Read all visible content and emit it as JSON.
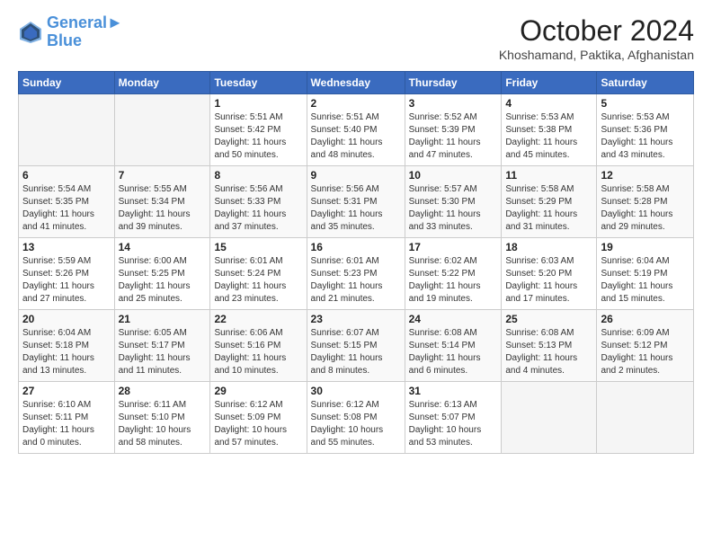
{
  "header": {
    "logo_line1": "General",
    "logo_line2": "Blue",
    "month": "October 2024",
    "location": "Khoshamand, Paktika, Afghanistan"
  },
  "days_of_week": [
    "Sunday",
    "Monday",
    "Tuesday",
    "Wednesday",
    "Thursday",
    "Friday",
    "Saturday"
  ],
  "weeks": [
    [
      {
        "day": "",
        "detail": ""
      },
      {
        "day": "",
        "detail": ""
      },
      {
        "day": "1",
        "detail": "Sunrise: 5:51 AM\nSunset: 5:42 PM\nDaylight: 11 hours\nand 50 minutes."
      },
      {
        "day": "2",
        "detail": "Sunrise: 5:51 AM\nSunset: 5:40 PM\nDaylight: 11 hours\nand 48 minutes."
      },
      {
        "day": "3",
        "detail": "Sunrise: 5:52 AM\nSunset: 5:39 PM\nDaylight: 11 hours\nand 47 minutes."
      },
      {
        "day": "4",
        "detail": "Sunrise: 5:53 AM\nSunset: 5:38 PM\nDaylight: 11 hours\nand 45 minutes."
      },
      {
        "day": "5",
        "detail": "Sunrise: 5:53 AM\nSunset: 5:36 PM\nDaylight: 11 hours\nand 43 minutes."
      }
    ],
    [
      {
        "day": "6",
        "detail": "Sunrise: 5:54 AM\nSunset: 5:35 PM\nDaylight: 11 hours\nand 41 minutes."
      },
      {
        "day": "7",
        "detail": "Sunrise: 5:55 AM\nSunset: 5:34 PM\nDaylight: 11 hours\nand 39 minutes."
      },
      {
        "day": "8",
        "detail": "Sunrise: 5:56 AM\nSunset: 5:33 PM\nDaylight: 11 hours\nand 37 minutes."
      },
      {
        "day": "9",
        "detail": "Sunrise: 5:56 AM\nSunset: 5:31 PM\nDaylight: 11 hours\nand 35 minutes."
      },
      {
        "day": "10",
        "detail": "Sunrise: 5:57 AM\nSunset: 5:30 PM\nDaylight: 11 hours\nand 33 minutes."
      },
      {
        "day": "11",
        "detail": "Sunrise: 5:58 AM\nSunset: 5:29 PM\nDaylight: 11 hours\nand 31 minutes."
      },
      {
        "day": "12",
        "detail": "Sunrise: 5:58 AM\nSunset: 5:28 PM\nDaylight: 11 hours\nand 29 minutes."
      }
    ],
    [
      {
        "day": "13",
        "detail": "Sunrise: 5:59 AM\nSunset: 5:26 PM\nDaylight: 11 hours\nand 27 minutes."
      },
      {
        "day": "14",
        "detail": "Sunrise: 6:00 AM\nSunset: 5:25 PM\nDaylight: 11 hours\nand 25 minutes."
      },
      {
        "day": "15",
        "detail": "Sunrise: 6:01 AM\nSunset: 5:24 PM\nDaylight: 11 hours\nand 23 minutes."
      },
      {
        "day": "16",
        "detail": "Sunrise: 6:01 AM\nSunset: 5:23 PM\nDaylight: 11 hours\nand 21 minutes."
      },
      {
        "day": "17",
        "detail": "Sunrise: 6:02 AM\nSunset: 5:22 PM\nDaylight: 11 hours\nand 19 minutes."
      },
      {
        "day": "18",
        "detail": "Sunrise: 6:03 AM\nSunset: 5:20 PM\nDaylight: 11 hours\nand 17 minutes."
      },
      {
        "day": "19",
        "detail": "Sunrise: 6:04 AM\nSunset: 5:19 PM\nDaylight: 11 hours\nand 15 minutes."
      }
    ],
    [
      {
        "day": "20",
        "detail": "Sunrise: 6:04 AM\nSunset: 5:18 PM\nDaylight: 11 hours\nand 13 minutes."
      },
      {
        "day": "21",
        "detail": "Sunrise: 6:05 AM\nSunset: 5:17 PM\nDaylight: 11 hours\nand 11 minutes."
      },
      {
        "day": "22",
        "detail": "Sunrise: 6:06 AM\nSunset: 5:16 PM\nDaylight: 11 hours\nand 10 minutes."
      },
      {
        "day": "23",
        "detail": "Sunrise: 6:07 AM\nSunset: 5:15 PM\nDaylight: 11 hours\nand 8 minutes."
      },
      {
        "day": "24",
        "detail": "Sunrise: 6:08 AM\nSunset: 5:14 PM\nDaylight: 11 hours\nand 6 minutes."
      },
      {
        "day": "25",
        "detail": "Sunrise: 6:08 AM\nSunset: 5:13 PM\nDaylight: 11 hours\nand 4 minutes."
      },
      {
        "day": "26",
        "detail": "Sunrise: 6:09 AM\nSunset: 5:12 PM\nDaylight: 11 hours\nand 2 minutes."
      }
    ],
    [
      {
        "day": "27",
        "detail": "Sunrise: 6:10 AM\nSunset: 5:11 PM\nDaylight: 11 hours\nand 0 minutes."
      },
      {
        "day": "28",
        "detail": "Sunrise: 6:11 AM\nSunset: 5:10 PM\nDaylight: 10 hours\nand 58 minutes."
      },
      {
        "day": "29",
        "detail": "Sunrise: 6:12 AM\nSunset: 5:09 PM\nDaylight: 10 hours\nand 57 minutes."
      },
      {
        "day": "30",
        "detail": "Sunrise: 6:12 AM\nSunset: 5:08 PM\nDaylight: 10 hours\nand 55 minutes."
      },
      {
        "day": "31",
        "detail": "Sunrise: 6:13 AM\nSunset: 5:07 PM\nDaylight: 10 hours\nand 53 minutes."
      },
      {
        "day": "",
        "detail": ""
      },
      {
        "day": "",
        "detail": ""
      }
    ]
  ]
}
